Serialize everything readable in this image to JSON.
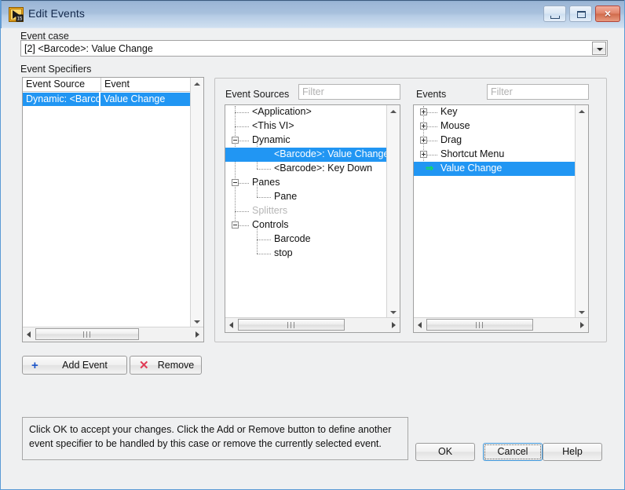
{
  "window": {
    "title": "Edit Events",
    "icon": "labview-event-icon",
    "controls": {
      "minimize": "minimize-button",
      "maximize": "maximize-button",
      "close": "×"
    },
    "accent_blue": "#2196f3",
    "titlebar_blue": "#a8c1dd"
  },
  "event_case": {
    "label": "Event case",
    "value": "[2] <Barcode>: Value Change"
  },
  "event_specifiers": {
    "label": "Event Specifiers",
    "columns": [
      "Event Source",
      "Event"
    ],
    "rows": [
      {
        "source": "Dynamic: <Barcode>",
        "event": "Value Change",
        "selected": true
      }
    ]
  },
  "event_sources": {
    "label": "Event Sources",
    "filter_placeholder": "Filter",
    "filter_value": "",
    "nodes": [
      {
        "label": "<Application>",
        "depth": 1,
        "expander": "none",
        "selected": false,
        "disabled": false
      },
      {
        "label": "<This VI>",
        "depth": 1,
        "expander": "none",
        "selected": false,
        "disabled": false
      },
      {
        "label": "Dynamic",
        "depth": 1,
        "expander": "minus",
        "selected": false,
        "disabled": false
      },
      {
        "label": "<Barcode>: Value Change",
        "depth": 2,
        "expander": "none",
        "selected": true,
        "disabled": false
      },
      {
        "label": "<Barcode>: Key Down",
        "depth": 2,
        "expander": "none",
        "selected": false,
        "disabled": false
      },
      {
        "label": "Panes",
        "depth": 1,
        "expander": "minus",
        "selected": false,
        "disabled": false
      },
      {
        "label": "Pane",
        "depth": 2,
        "expander": "none",
        "selected": false,
        "disabled": false
      },
      {
        "label": "Splitters",
        "depth": 1,
        "expander": "none",
        "selected": false,
        "disabled": true
      },
      {
        "label": "Controls",
        "depth": 1,
        "expander": "minus",
        "selected": false,
        "disabled": false
      },
      {
        "label": "Barcode",
        "depth": 2,
        "expander": "none",
        "selected": false,
        "disabled": false
      },
      {
        "label": "stop",
        "depth": 2,
        "expander": "none",
        "selected": false,
        "disabled": false
      }
    ]
  },
  "events": {
    "label": "Events",
    "filter_placeholder": "Filter",
    "filter_value": "",
    "nodes": [
      {
        "label": "Key",
        "depth": 1,
        "expander": "plus",
        "selected": false,
        "arrow": false
      },
      {
        "label": "Mouse",
        "depth": 1,
        "expander": "plus",
        "selected": false,
        "arrow": false
      },
      {
        "label": "Drag",
        "depth": 1,
        "expander": "plus",
        "selected": false,
        "arrow": false
      },
      {
        "label": "Shortcut Menu",
        "depth": 1,
        "expander": "plus",
        "selected": false,
        "arrow": false
      },
      {
        "label": "Value Change",
        "depth": 1,
        "expander": "none",
        "selected": true,
        "arrow": true
      }
    ]
  },
  "actions": {
    "add_event": "Add Event",
    "add_event_icon": "plus-icon",
    "add_event_glyph": "+",
    "remove": "Remove",
    "remove_icon": "x-icon",
    "remove_glyph": "✕"
  },
  "hint": {
    "text": "Click OK to accept your changes.  Click the Add or Remove button to define another event specifier to be handled by this case or remove the currently selected event."
  },
  "dialog_buttons": {
    "ok": "OK",
    "cancel": "Cancel",
    "help": "Help"
  }
}
